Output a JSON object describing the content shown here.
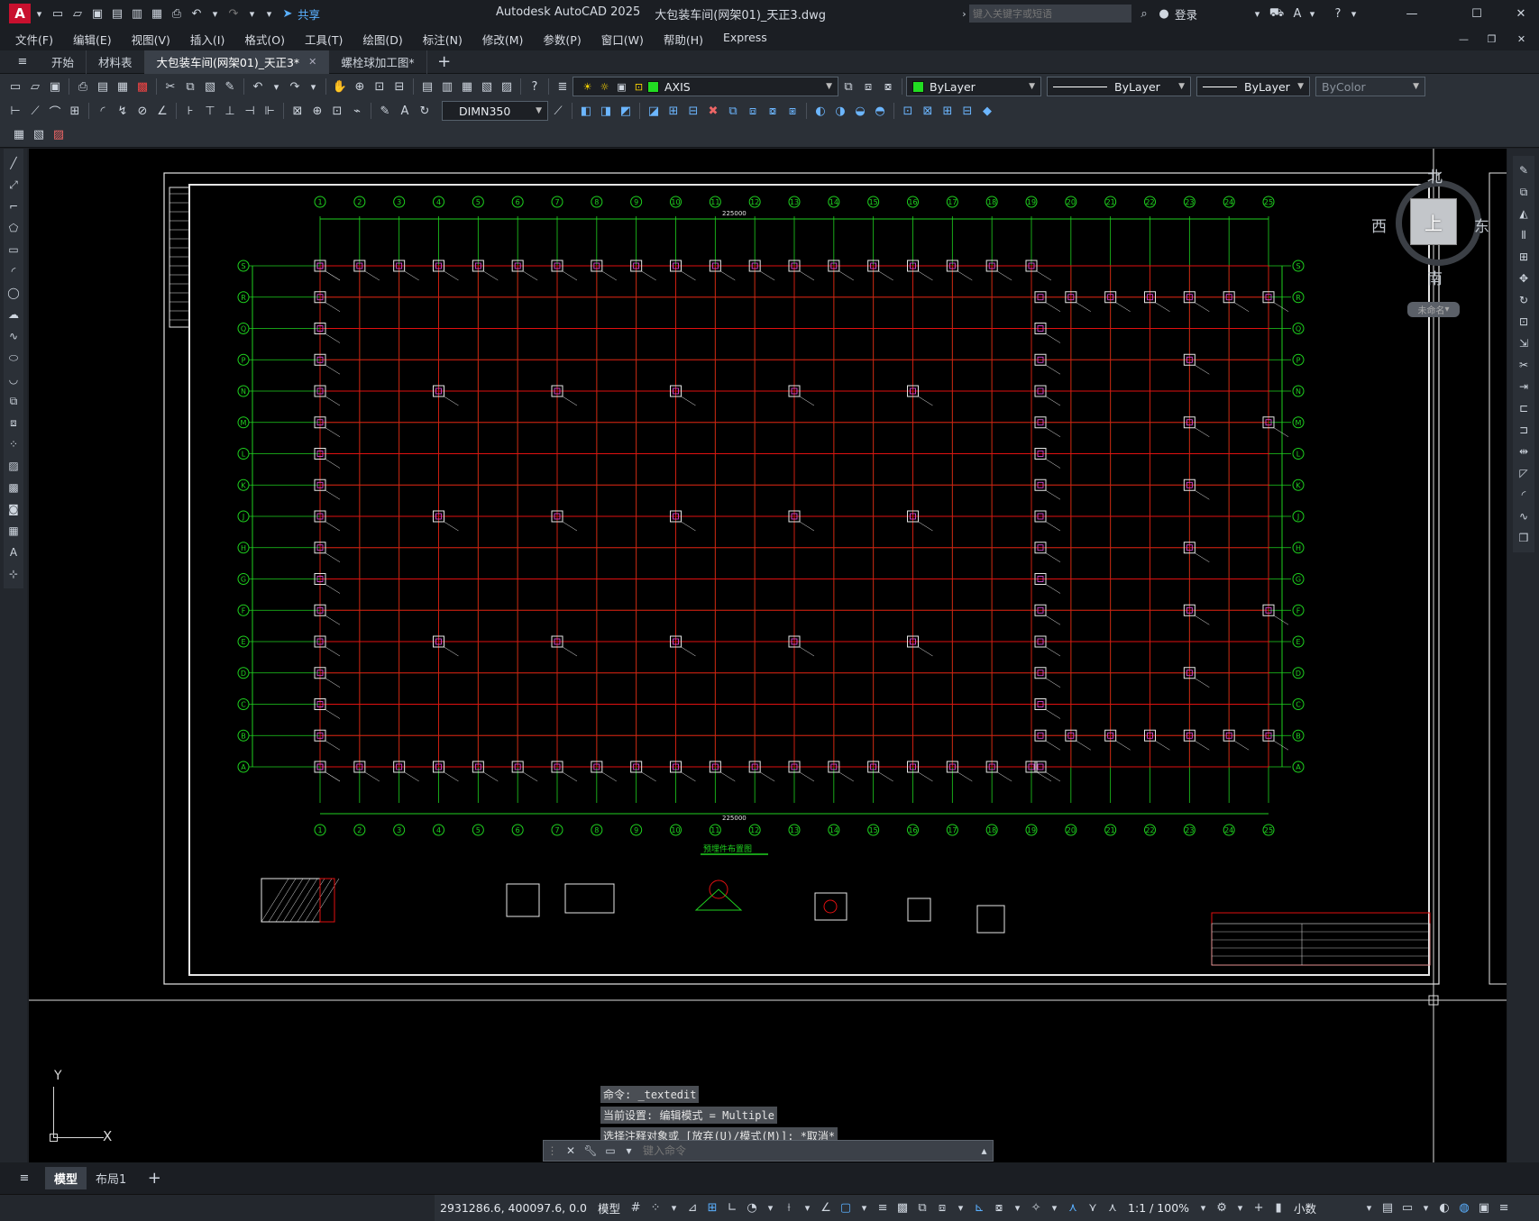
{
  "app_title": "Autodesk AutoCAD 2025",
  "file_title": "大包装车间(网架01)_天正3.dwg",
  "quick_access": {
    "share_label": "共享",
    "app_logo": "A"
  },
  "search": {
    "placeholder": "键入关键字或短语"
  },
  "account": {
    "login_label": "登录"
  },
  "menus": [
    "文件(F)",
    "编辑(E)",
    "视图(V)",
    "插入(I)",
    "格式(O)",
    "工具(T)",
    "绘图(D)",
    "标注(N)",
    "修改(M)",
    "参数(P)",
    "窗口(W)",
    "帮助(H)",
    "Express"
  ],
  "tabs": [
    {
      "label": "开始",
      "active": false,
      "closable": false
    },
    {
      "label": "材料表",
      "active": false,
      "closable": false
    },
    {
      "label": "大包装车间(网架01)_天正3*",
      "active": true,
      "closable": true
    },
    {
      "label": "螺栓球加工图*",
      "active": false,
      "closable": false
    }
  ],
  "properties": {
    "layer": "AXIS",
    "layer_color": "#22dd22",
    "color": "ByLayer",
    "color_swatch": "#22dd22",
    "linetype": "ByLayer",
    "lineweight": "ByLayer",
    "plotstyle": "ByColor",
    "dimstyle": "DIMN350"
  },
  "viewcube": {
    "north": "北",
    "south": "南",
    "east": "东",
    "west": "西",
    "face": "上",
    "wcs": "未命名"
  },
  "drawing": {
    "grid_numbers": [
      "1",
      "2",
      "3",
      "4",
      "5",
      "6",
      "7",
      "8",
      "9",
      "10",
      "11",
      "12",
      "13",
      "14",
      "15",
      "16",
      "17",
      "18",
      "19",
      "20",
      "21",
      "22",
      "23",
      "24",
      "25"
    ],
    "grid_letters": [
      "S",
      "R",
      "Q",
      "P",
      "N",
      "M",
      "L",
      "K",
      "J",
      "H",
      "G",
      "F",
      "E",
      "D",
      "C",
      "B",
      "A"
    ],
    "section_title": "预埋件布置图",
    "overall_dim": "225000"
  },
  "command_history": [
    "命令: _textedit",
    "当前设置: 编辑模式 = Multiple",
    "选择注释对象或 [放弃(U)/模式(M)]: *取消*"
  ],
  "command_input": {
    "placeholder": "键入命令"
  },
  "ucs": {
    "x": "X",
    "y": "Y"
  },
  "layouts": [
    {
      "label": "模型",
      "active": true
    },
    {
      "label": "布局1",
      "active": false
    }
  ],
  "status": {
    "coords": "2931286.6, 400097.6, 0.0",
    "model_label": "模型",
    "scale": "1:1 / 100%",
    "units": "小数"
  }
}
